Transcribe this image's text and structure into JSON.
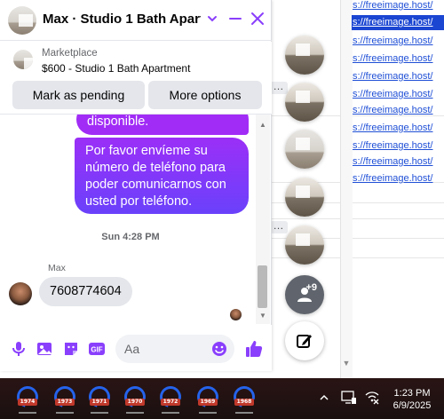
{
  "chat": {
    "title": "Max · Studio 1 Bath Apart...",
    "marketplace_label": "Marketplace",
    "listing_title": "$600 - Studio 1 Bath Apartment",
    "mark_pending_label": "Mark as pending",
    "more_options_label": "More options",
    "messages": {
      "outgoing_partial": "disponible.",
      "outgoing_full": "Por favor envíeme su número de teléfono para poder comunicarnos con usted por teléfono.",
      "timestamp": "Sun 4:28 PM",
      "sender_name": "Max",
      "incoming": "7608774604"
    },
    "composer": {
      "placeholder": "Aa",
      "gif_label": "GIF"
    },
    "accent_color": "#8a3ffc"
  },
  "bubbles": {
    "group_badge": "+9"
  },
  "background_links": [
    "s://freeimage.host/",
    "s://freeimage.host/",
    "s://freeimage.host/",
    "s://freeimage.host/",
    "s://freeimage.host/",
    "s://freeimage.host/",
    "s://freeimage.host/",
    "s://freeimage.host/",
    "s://freeimage.host/",
    "s://freeimage.host/",
    "s://freeimage.host/"
  ],
  "taskbar": {
    "apps": [
      "1974",
      "1973",
      "1971",
      "1970",
      "1972",
      "1969",
      "1968"
    ],
    "time": "1:23 PM",
    "date": "6/9/2025"
  }
}
